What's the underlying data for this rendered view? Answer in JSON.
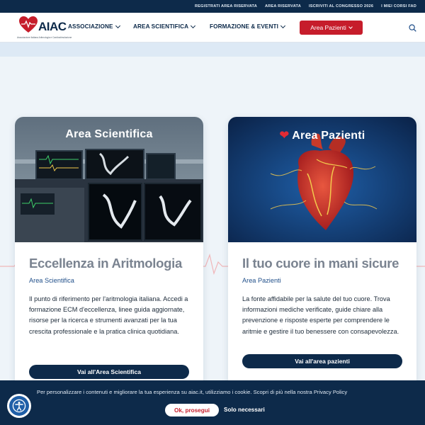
{
  "topbar": {
    "links": [
      "REGISTRATI AREA RISERVATA",
      "AREA RISERVATA",
      "ISCRIVITI AL CONGRESSO 2026",
      "I MIEI CORSI FAD"
    ]
  },
  "header": {
    "logo_text": "AIAC",
    "logo_subtitle": "Associazione Italiana Aritmologia e Cardiostimolazione",
    "nav": [
      {
        "label": "ASSOCIAZIONE"
      },
      {
        "label": "AREA SCIENTIFICA"
      },
      {
        "label": "FORMAZIONE & EVENTI"
      }
    ],
    "cta_label": "Area Pazienti",
    "search_icon": "search-icon"
  },
  "cards": [
    {
      "image_title": "Area Scientifica",
      "heading": "Eccellenza in Aritmologia",
      "subtitle": "Area Scientifica",
      "text": "Il punto di riferimento per l'aritmologia italiana. Accedi a formazione ECM d'eccellenza, linee guida aggiornate, risorse per la ricerca e strumenti avanzati per la tua crescita professionale e la pratica clinica quotidiana.",
      "button": "Vai all'Area Scientifica"
    },
    {
      "image_title": "Area Pazienti",
      "heading": "Il tuo cuore in mani sicure",
      "subtitle": "Area Pazienti",
      "text": "La fonte affidabile per la salute del tuo cuore. Trova informazioni mediche verificate, guide chiare alla prevenzione e risposte esperte per comprendere le aritmie e gestire il tuo benessere con consapevolezza.",
      "button": "Vai all'area pazienti"
    }
  ],
  "cookie": {
    "text": "Per personalizzare i contenuti e migliorare la tua esperienza su aiac.it, utilizziamo i cookie. Scopri di più nella nostra Privacy Policy",
    "accept": "Ok, prosegui",
    "necessary": "Solo necessari"
  },
  "colors": {
    "navy": "#0d2a4a",
    "red": "#c61d2b",
    "link_blue": "#1f4e89",
    "heading_gray": "#7a8390"
  }
}
